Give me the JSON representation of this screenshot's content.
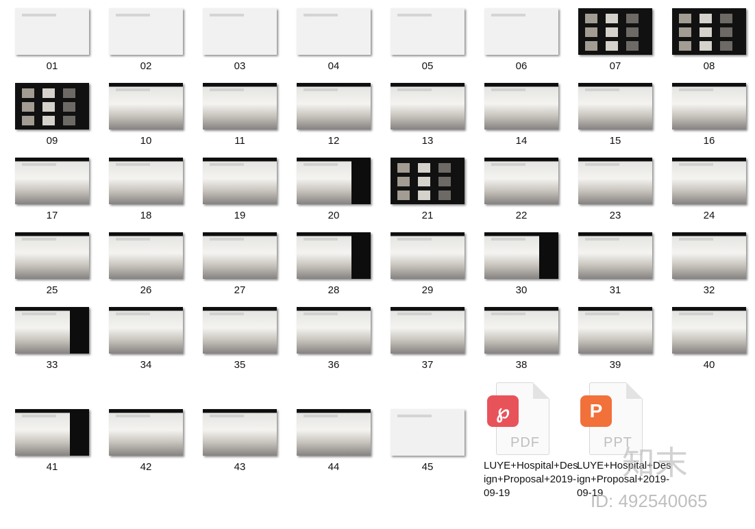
{
  "thumbnails": [
    {
      "label": "01",
      "style": "light"
    },
    {
      "label": "02",
      "style": "light"
    },
    {
      "label": "03",
      "style": "light"
    },
    {
      "label": "04",
      "style": "light"
    },
    {
      "label": "05",
      "style": "light"
    },
    {
      "label": "06",
      "style": "light"
    },
    {
      "label": "07",
      "style": "dark"
    },
    {
      "label": "08",
      "style": "dark"
    },
    {
      "label": "09",
      "style": "dark"
    },
    {
      "label": "10",
      "style": "room"
    },
    {
      "label": "11",
      "style": "room"
    },
    {
      "label": "12",
      "style": "room"
    },
    {
      "label": "13",
      "style": "room"
    },
    {
      "label": "14",
      "style": "room"
    },
    {
      "label": "15",
      "style": "room"
    },
    {
      "label": "16",
      "style": "room"
    },
    {
      "label": "17",
      "style": "room"
    },
    {
      "label": "18",
      "style": "room"
    },
    {
      "label": "19",
      "style": "room"
    },
    {
      "label": "20",
      "style": "panel"
    },
    {
      "label": "21",
      "style": "dark"
    },
    {
      "label": "22",
      "style": "room"
    },
    {
      "label": "23",
      "style": "room"
    },
    {
      "label": "24",
      "style": "room"
    },
    {
      "label": "25",
      "style": "room"
    },
    {
      "label": "26",
      "style": "room"
    },
    {
      "label": "27",
      "style": "room"
    },
    {
      "label": "28",
      "style": "panel"
    },
    {
      "label": "29",
      "style": "room"
    },
    {
      "label": "30",
      "style": "panel"
    },
    {
      "label": "31",
      "style": "room"
    },
    {
      "label": "32",
      "style": "room"
    },
    {
      "label": "33",
      "style": "panel"
    },
    {
      "label": "34",
      "style": "room"
    },
    {
      "label": "35",
      "style": "room"
    },
    {
      "label": "36",
      "style": "room"
    },
    {
      "label": "37",
      "style": "room"
    },
    {
      "label": "38",
      "style": "room"
    },
    {
      "label": "39",
      "style": "room"
    },
    {
      "label": "40",
      "style": "room"
    },
    {
      "label": "41",
      "style": "panel"
    },
    {
      "label": "42",
      "style": "room"
    },
    {
      "label": "43",
      "style": "room"
    },
    {
      "label": "44",
      "style": "room"
    },
    {
      "label": "45",
      "style": "light"
    }
  ],
  "files": [
    {
      "name": "LUYE+Hospital+Design+Proposal+2019-09-19",
      "type": "PDF",
      "badge_color": "#e8535a",
      "badge_glyph": "℘",
      "icon": "pdf-file-icon"
    },
    {
      "name": "LUYE+Hospital+Design+Proposal+2019-09-19",
      "type": "PPT",
      "badge_color": "#f2703a",
      "badge_glyph": "P",
      "icon": "ppt-file-icon"
    }
  ],
  "watermark": {
    "brand": "知末",
    "id": "ID: 492540065"
  }
}
